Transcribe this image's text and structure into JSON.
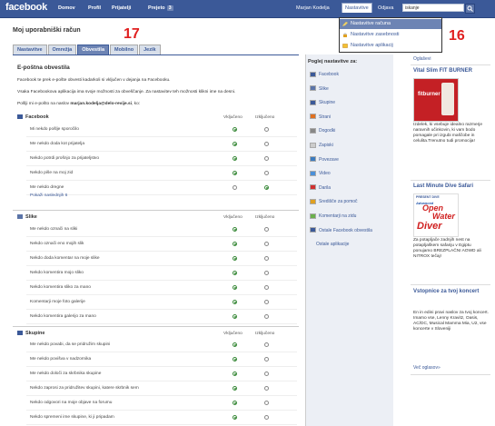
{
  "topbar": {
    "logo": "facebook",
    "nav": [
      "Domov",
      "Profil",
      "Prijatelji",
      "Prejeto"
    ],
    "inbox_count": "3",
    "user": "Marjan Kodelja",
    "settings": "Nastavitve",
    "logout": "Odjava",
    "search_value": "iskanje"
  },
  "dropdown": {
    "items": [
      "Nastavitve računa",
      "Nastavitve zasebnosti",
      "Nastavitve aplikacij"
    ]
  },
  "annotations": {
    "left": "17",
    "right": "16"
  },
  "page": {
    "title": "Moj uporabniški račun",
    "tabs": [
      "Nastavitve",
      "Omrežja",
      "Obvestila",
      "Mobilno",
      "Jezik"
    ],
    "active_tab": "Obvestila",
    "section_title": "E-poštna obvestila",
    "desc1": "Facebook te prek e-pošte obvesti kadarkoli si vključen v dejanja na Facebooku.",
    "desc2": "Vsaka Facebookova aplikacija ima svoje možnosti za obveščanje. Za nastavitev teh možnosti klikni ime na desni.",
    "desc3_prefix": "Pošlji mi e-pošto na naslov",
    "email": "marjan.kodelja@delo-revije.si",
    "desc3_suffix": ", ko:",
    "col_on": "Vključeno",
    "col_off": "Izključeno"
  },
  "groups": {
    "facebook": {
      "title": "Facebook",
      "rows": [
        {
          "label": "Mi nekdo pošlje sporočilo",
          "on": true
        },
        {
          "label": "Me nekdo doda kot prijatelja",
          "on": true
        },
        {
          "label": "Nekdo potrdi prošnjo za prijateljstvo",
          "on": true
        },
        {
          "label": "Nekdo piše na moj zid",
          "on": true
        },
        {
          "label": "Me nekdo dregne",
          "on": false
        }
      ],
      "more": "Pokaži naslednjih 6"
    },
    "slike": {
      "title": "Slike",
      "rows": [
        {
          "label": "Me nekdo označi na sliki",
          "on": true
        },
        {
          "label": "Nekdo označi eno mojih slik",
          "on": true
        },
        {
          "label": "Nekdo doda komentar na moje slike",
          "on": true
        },
        {
          "label": "Nekdo komentira mojo sliko",
          "on": true
        },
        {
          "label": "Nekdo komentira sliko za mano",
          "on": true
        },
        {
          "label": "Komentarji moje foto galerije",
          "on": true
        },
        {
          "label": "Nekdo komentira galerijo za mano",
          "on": true
        }
      ]
    },
    "skupine": {
      "title": "Skupine",
      "rows": [
        {
          "label": "Me nekdo povabi, da se pridružim skupini",
          "on": true
        },
        {
          "label": "Me nekdo povišva v nadzornika",
          "on": true
        },
        {
          "label": "Me nekdo določi za skrbnika skupine",
          "on": true
        },
        {
          "label": "Nekdo zaprosi za pridružitev skupini, katere skrbnik sem",
          "on": true
        },
        {
          "label": "Nekdo odgovori na moje objave na forumu",
          "on": true
        },
        {
          "label": "Nekdo spremeni ime skupine, ki ji pripadam",
          "on": true
        }
      ]
    }
  },
  "midnav": {
    "title": "Poglej nastavitve za:",
    "items": [
      "Facebook",
      "Slike",
      "Skupine",
      "Strani",
      "Dogodki",
      "Zapiski",
      "Povezave",
      "Video",
      "Darila",
      "Središče za pomoč",
      "Komentarji na zidu",
      "Ostale Facebook obvestila",
      "Ostale aplikacije"
    ],
    "icon_colors": [
      "#3b5998",
      "#5b74a8",
      "#3b5998",
      "#e07020",
      "#888888",
      "#cccccc",
      "#3b7bbf",
      "#4a90d9",
      "#d03030",
      "#e0a020",
      "#6ab04c",
      "#3b5998",
      "#ffffff"
    ]
  },
  "ads": {
    "oglasi": "Oglaševi",
    "ad1_title": "Vital Slim FIT BURNER",
    "ad1_img": "fitburner",
    "ad1_text": "Izdelek, ki vsebuje idealno razmerje naravnih učinkovin, ki vam bodo pomagale pri izgubi maščobe in celulita.Trenutno tudi promocija!",
    "ad2_title": "Last Minute Dive Safari",
    "ad2_img_small": "PRESENT DIVE",
    "ad2_img_line1": "Advanced",
    "ad2_img_line2": "Open",
    "ad2_img_line3": "Water",
    "ad2_img_line4": "Diver",
    "ad2_text": "Za potapljače zadnjih nest na potapljaškem safariju v Egiptu ponujamo BREZPLAČNI AOWD ali NITROX tečaj!",
    "ad3_title": "Vstopnice za tvoj koncert",
    "ad3_text": "En in edini pravi naslov za tvoj koncert. Imamo vse, Lenny Kravitz, Oasis, AC/DC, Musical Mamma Mia, U2, vse koncerte v Sloveniji",
    "more": "Več oglasov»"
  }
}
